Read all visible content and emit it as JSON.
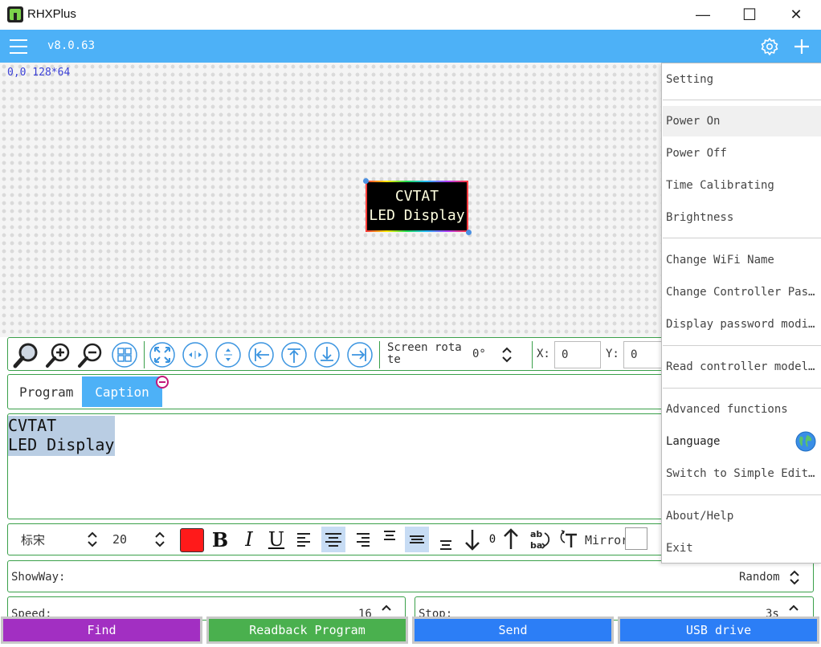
{
  "app": {
    "title": "RHXPlus",
    "version": "v8.0.63"
  },
  "window_controls": {
    "minimize": "—",
    "maximize": "☐",
    "close": "✕"
  },
  "canvas": {
    "coord_label": "0,0 128*64",
    "preview_lines": [
      "CVTAT",
      "LED Display"
    ]
  },
  "toolbar": {
    "screen_rotate_label": "Screen rota te",
    "rotate_value": "0°",
    "x_label": "X:",
    "x_value": "0",
    "y_label": "Y:",
    "y_value": "0"
  },
  "tabs": {
    "program": "Program",
    "caption": "Caption"
  },
  "editor": {
    "text": "CVTAT\nLED Display"
  },
  "format": {
    "font_family": "标宋",
    "font_size": "20",
    "text_color": "#ff1a1a",
    "rotate_value": "0",
    "mirror_label": "Mirror"
  },
  "showway": {
    "label": "ShowWay:",
    "value": "Random"
  },
  "speed": {
    "label": "Speed:",
    "value": "16"
  },
  "stop": {
    "label": "Stop:",
    "value": "3s"
  },
  "buttons": {
    "find": "Find",
    "readback": "Readback Program",
    "send": "Send",
    "usb": "USB drive"
  },
  "menu": {
    "setting": "Setting",
    "power_on": "Power On",
    "power_off": "Power Off",
    "time_calibrating": "Time Calibrating",
    "brightness": "Brightness",
    "change_wifi_name": "Change WiFi Name",
    "change_controller_password": "Change Controller Pas…",
    "display_password": "Display password modi…",
    "read_controller_model": "Read controller model…",
    "advanced_functions": "Advanced functions",
    "language": "Language",
    "switch_simple_editor": "Switch to Simple Edit…",
    "about_help": "About/Help",
    "exit": "Exit"
  },
  "colors": {
    "accent": "#4db1f7",
    "find": "#a22fc2",
    "readback": "#4ab04e",
    "send": "#2c7ef6",
    "border_green": "#3aa04a",
    "coord_text": "#3a3fd6"
  }
}
